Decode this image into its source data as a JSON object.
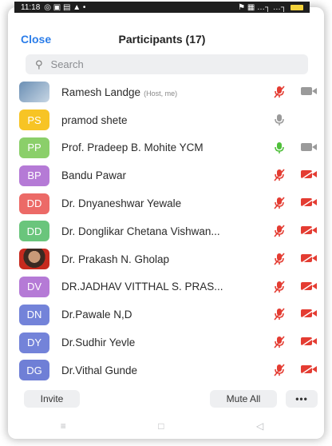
{
  "status": {
    "time": "11:18",
    "left_icons": "◎ ▣ ▤ ▲ •",
    "right_icons": "⚑ ▦ …┐ …┐"
  },
  "header": {
    "close": "Close",
    "title": "Participants (17)"
  },
  "search": {
    "placeholder": "Search"
  },
  "participants": [
    {
      "initials": "",
      "photo": true,
      "name": "Ramesh Landge",
      "role": "(Host, me)",
      "mic": "muted",
      "cam": "gray"
    },
    {
      "initials": "PS",
      "color": "#f7c425",
      "name": "pramod shete",
      "role": "",
      "mic": "gray",
      "cam": "none"
    },
    {
      "initials": "PP",
      "color": "#8bcf6a",
      "name": "Prof. Pradeep B. Mohite YCM",
      "role": "",
      "mic": "green",
      "cam": "gray"
    },
    {
      "initials": "BP",
      "color": "#b57ad6",
      "name": "Bandu Pawar",
      "role": "",
      "mic": "muted",
      "cam": "muted"
    },
    {
      "initials": "DD",
      "color": "#ec6a67",
      "name": "Dr. Dnyaneshwar Yewale",
      "role": "",
      "mic": "muted",
      "cam": "muted"
    },
    {
      "initials": "DD",
      "color": "#6ac57c",
      "name": "Dr. Donglikar Chetana Vishwan...",
      "role": "",
      "mic": "muted",
      "cam": "muted"
    },
    {
      "initials": "",
      "photo2": true,
      "name": "Dr. Prakash N. Gholap",
      "role": "",
      "mic": "muted",
      "cam": "muted"
    },
    {
      "initials": "DV",
      "color": "#b57ad6",
      "name": "DR.JADHAV VITTHAL S. PRAS...",
      "role": "",
      "mic": "muted",
      "cam": "muted"
    },
    {
      "initials": "DN",
      "color": "#7383d9",
      "name": "Dr.Pawale N,D",
      "role": "",
      "mic": "muted",
      "cam": "muted"
    },
    {
      "initials": "DY",
      "color": "#7383d9",
      "name": "Dr.Sudhir Yevle",
      "role": "",
      "mic": "muted",
      "cam": "muted"
    },
    {
      "initials": "DG",
      "color": "#6f7fd6",
      "name": "Dr.Vithal Gunde",
      "role": "",
      "mic": "muted",
      "cam": "muted"
    }
  ],
  "footer": {
    "invite": "Invite",
    "mute_all": "Mute All",
    "more": "•••"
  },
  "navbar": {
    "menu": "≡",
    "home": "□",
    "back": "◁"
  },
  "colors": {
    "accent": "#2b7de9",
    "muted_red": "#e43c32",
    "icon_gray": "#9a9a9a",
    "green": "#4fbf3a"
  }
}
